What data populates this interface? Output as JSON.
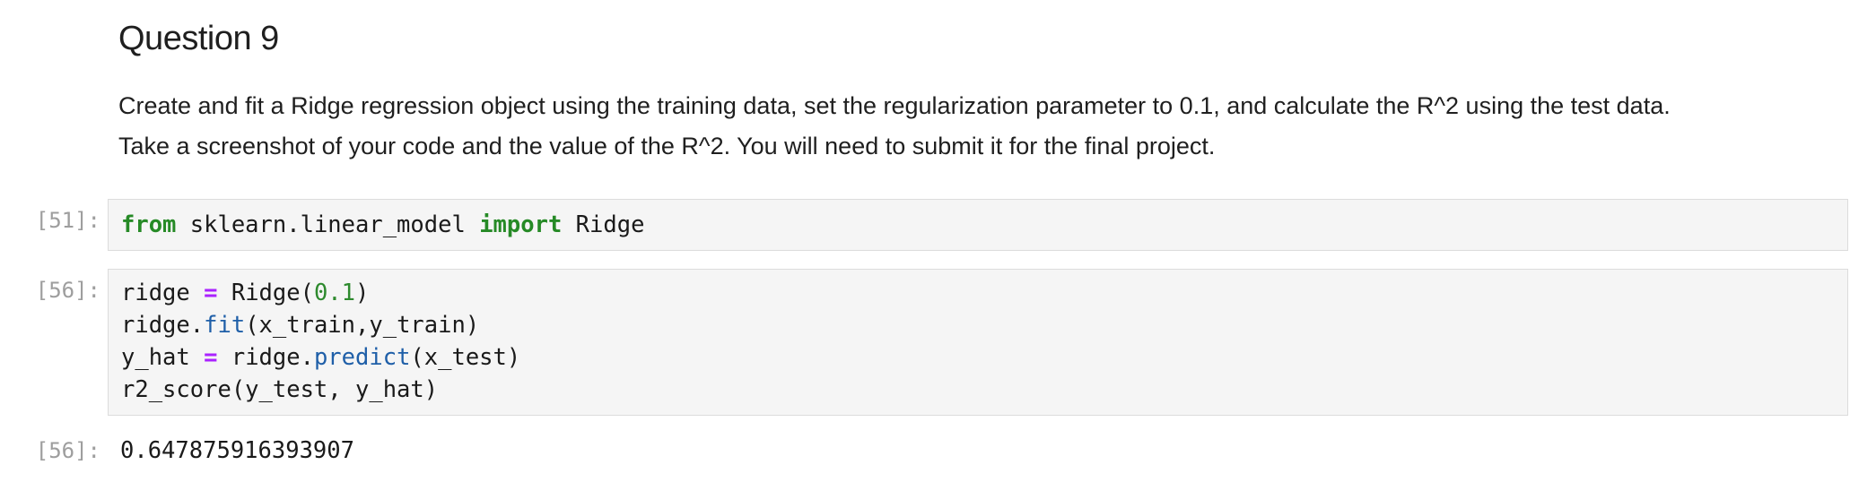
{
  "markdown": {
    "heading": "Question 9",
    "paragraph_line1": "Create and fit a Ridge regression object using the training data, set the regularization parameter to 0.1, and calculate the R^2 using the test data.",
    "paragraph_line2": "Take a screenshot of your code and the value of the R^2. You will need to submit it for the final project."
  },
  "cells": [
    {
      "prompt": "[51]:",
      "code": {
        "line1": {
          "kw1": "from",
          "mod": " sklearn.linear_model ",
          "kw2": "import",
          "name": " Ridge"
        }
      }
    },
    {
      "prompt": "[56]:",
      "code": {
        "line1": {
          "a": "ridge ",
          "op": "=",
          "b": " Ridge(",
          "num": "0.1",
          "c": ")"
        },
        "line2": {
          "a": "ridge.",
          "fn": "fit",
          "b": "(x_train,y_train)"
        },
        "line3": {
          "a": "y_hat ",
          "op": "=",
          "b": " ridge.",
          "fn": "predict",
          "c": "(x_test)"
        },
        "line4": {
          "a": "r2_score(y_test, y_hat)"
        }
      },
      "output_prompt": "[56]:",
      "output": "0.647875916393907"
    }
  ],
  "colors": {
    "keyword": "#268a26",
    "operator": "#aa22ff",
    "number": "#2e8a2e",
    "function": "#1f5fa8",
    "prompt": "#9e9e9e",
    "cell_bg": "#f5f5f5"
  }
}
